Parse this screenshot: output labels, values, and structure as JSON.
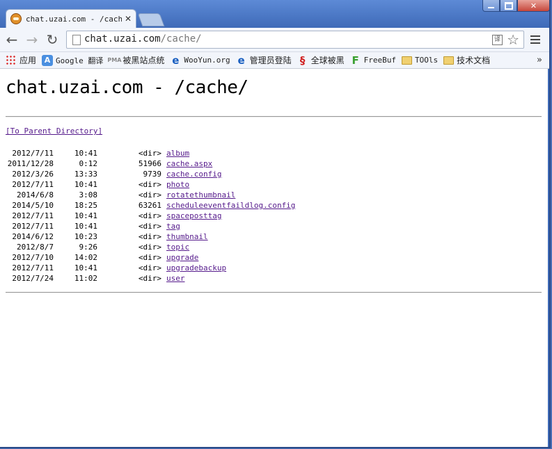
{
  "browser": {
    "tab": {
      "title": "chat.uzai.com - /cache/",
      "close_glyph": "✕",
      "favicon": "tiger-favicon-icon"
    },
    "window_controls": {
      "minimize": "minimize-icon",
      "maximize": "maximize-icon",
      "close": "✕"
    },
    "toolbar": {
      "back": "←",
      "forward": "→",
      "reload": "↻",
      "url_host": "chat.uzai.com",
      "url_path": "/cache/",
      "translate": "译",
      "star": "☆"
    },
    "bookmarks": [
      {
        "label": "应用",
        "icon": "apps-grid-icon"
      },
      {
        "label": "Google 翻译",
        "icon": "translate-icon"
      },
      {
        "label": "被黑站点统",
        "icon": "pma-icon"
      },
      {
        "label": "WooYun.org",
        "icon": "ie-icon"
      },
      {
        "label": "管理员登陆",
        "icon": "ie-icon"
      },
      {
        "label": "全球被黑",
        "icon": "red-swirl-icon"
      },
      {
        "label": "FreeBuf",
        "icon": "freebuf-icon"
      },
      {
        "label": "TOOls",
        "icon": "folder-icon"
      },
      {
        "label": "技术文档",
        "icon": "folder-icon"
      }
    ],
    "bookmarks_more": "»"
  },
  "page": {
    "heading": "chat.uzai.com - /cache/",
    "parent_link": "[To Parent Directory]",
    "entries": [
      {
        "date": "2012/7/11",
        "time": "10:41",
        "size": "<dir>",
        "name": "album"
      },
      {
        "date": "2011/12/28",
        "time": "0:12",
        "size": "51966",
        "name": "cache.aspx"
      },
      {
        "date": "2012/3/26",
        "time": "13:33",
        "size": "9739",
        "name": "cache.config"
      },
      {
        "date": "2012/7/11",
        "time": "10:41",
        "size": "<dir>",
        "name": "photo"
      },
      {
        "date": "2014/6/8",
        "time": "3:08",
        "size": "<dir>",
        "name": "rotatethumbnail"
      },
      {
        "date": "2014/5/10",
        "time": "18:25",
        "size": "63261",
        "name": "scheduleeventfaildlog.config"
      },
      {
        "date": "2012/7/11",
        "time": "10:41",
        "size": "<dir>",
        "name": "spaceposttag"
      },
      {
        "date": "2012/7/11",
        "time": "10:41",
        "size": "<dir>",
        "name": "tag"
      },
      {
        "date": "2014/6/12",
        "time": "10:23",
        "size": "<dir>",
        "name": "thumbnail"
      },
      {
        "date": "2012/8/7",
        "time": "9:26",
        "size": "<dir>",
        "name": "topic"
      },
      {
        "date": "2012/7/10",
        "time": "14:02",
        "size": "<dir>",
        "name": "upgrade"
      },
      {
        "date": "2012/7/11",
        "time": "10:41",
        "size": "<dir>",
        "name": "upgradebackup"
      },
      {
        "date": "2012/7/24",
        "time": "11:02",
        "size": "<dir>",
        "name": "user"
      }
    ]
  }
}
